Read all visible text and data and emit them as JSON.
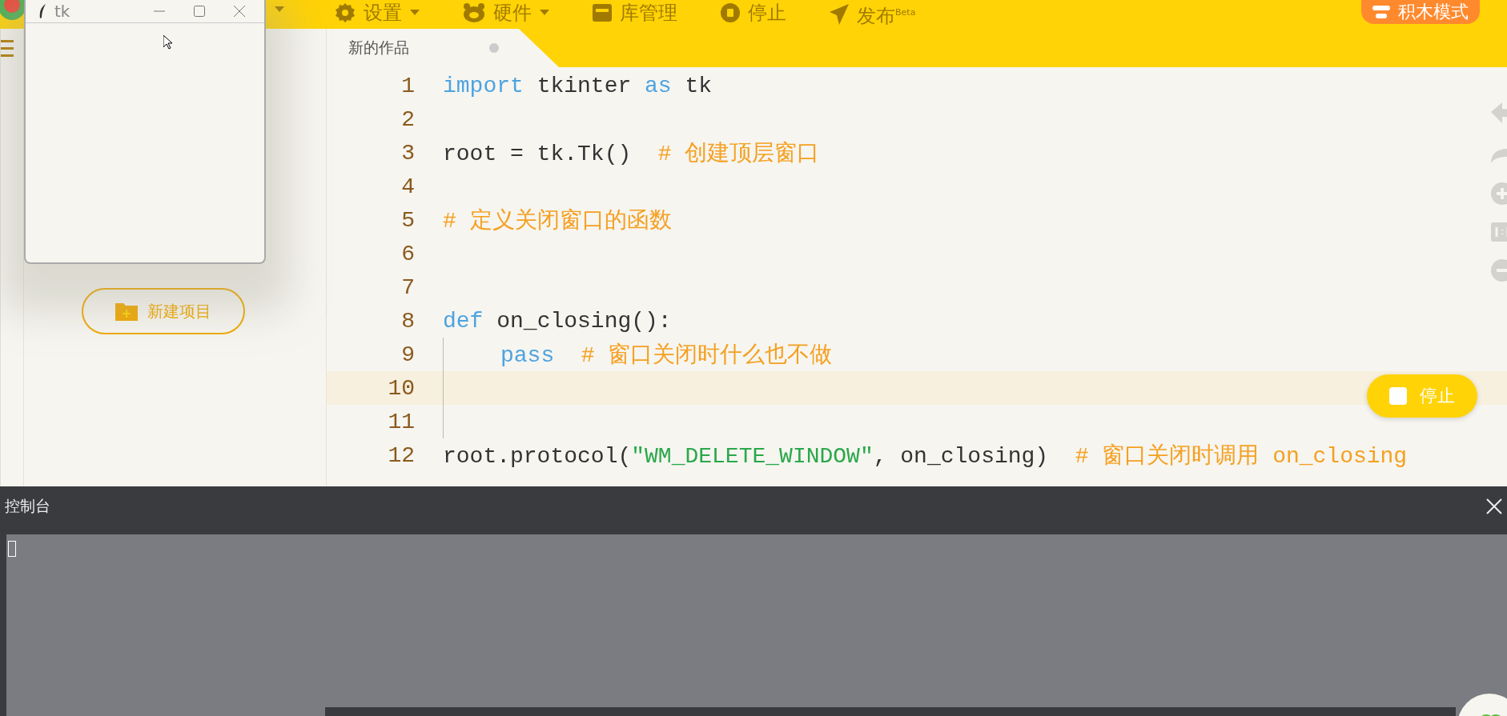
{
  "menu": [
    {
      "label": "设置",
      "dropdown": true
    },
    {
      "label": "硬件",
      "dropdown": true
    },
    {
      "label": "库管理",
      "dropdown": false
    },
    {
      "label": "停止",
      "dropdown": false
    },
    {
      "label": "发布$^{Beta}$",
      "dropdown": false
    }
  ],
  "mode_button": "积木模式",
  "tabs": [
    {
      "label": "新的作品",
      "selected": true
    }
  ],
  "sidebar": {
    "new_project": "新建项目"
  },
  "tk_window": {
    "title": "tk"
  },
  "editor": {
    "lines": [
      {
        "number": "1",
        "highlighted": false,
        "indented": false,
        "tokens": [
          {
            "kind": "keyword",
            "text": "import"
          },
          {
            "kind": "plain",
            "text": " tkinter "
          },
          {
            "kind": "keyword",
            "text": "as"
          },
          {
            "kind": "plain",
            "text": " tk"
          }
        ]
      },
      {
        "number": "2",
        "highlighted": false,
        "indented": false
      },
      {
        "number": "3",
        "highlighted": false,
        "indented": false,
        "tokens": [
          {
            "kind": "plain",
            "text": "root = tk.Tk()"
          },
          {
            "kind": "comment",
            "text": "# 创建顶层窗口"
          }
        ]
      },
      {
        "number": "4",
        "highlighted": false,
        "indented": false
      },
      {
        "number": "5",
        "highlighted": false,
        "indented": false,
        "tokens": [
          {
            "kind": "comment",
            "text": "# 定义关闭窗口的函数"
          }
        ]
      },
      {
        "number": "6",
        "highlighted": false,
        "indented": false
      },
      {
        "number": "7",
        "highlighted": false,
        "indented": false
      },
      {
        "number": "8",
        "highlighted": false,
        "indented": false,
        "tokens": [
          {
            "kind": "keyword",
            "text": "def"
          },
          {
            "kind": "plain",
            "text": " on_closing():"
          }
        ]
      },
      {
        "number": "9",
        "highlighted": false,
        "indented": true,
        "tokens": [
          {
            "kind": "keyword",
            "text": "pass"
          },
          {
            "kind": "comment",
            "text": "# 窗口关闭时什么也不做"
          }
        ]
      },
      {
        "number": "10",
        "highlighted": true,
        "indented": true
      },
      {
        "number": "11",
        "highlighted": false,
        "indented": true
      },
      {
        "number": "12",
        "highlighted": false,
        "indented": false,
        "tokens": [
          {
            "kind": "plain",
            "text": "root.protocol("
          },
          {
            "kind": "string",
            "text": "\"WM_DELETE_WINDOW\""
          },
          {
            "kind": "plain",
            "text": ", on_closing)"
          },
          {
            "kind": "comment",
            "text": "# 窗口关闭时调用 on_closing"
          }
        ]
      }
    ]
  },
  "stop_button": "停止",
  "console": {
    "title": "控制台"
  }
}
